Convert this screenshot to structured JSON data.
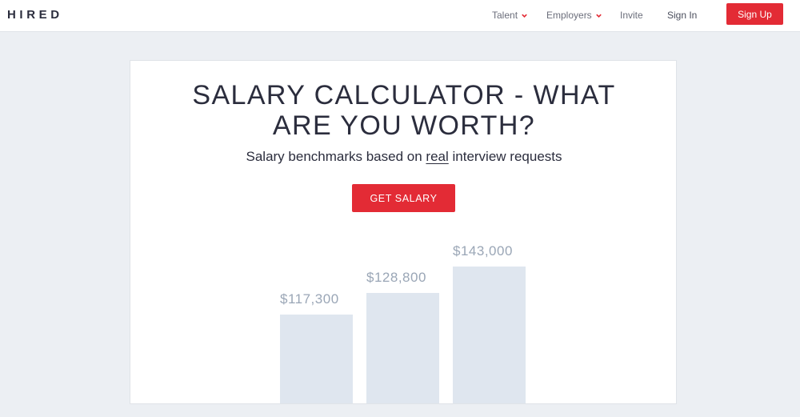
{
  "header": {
    "logo": "HIRED",
    "nav": [
      {
        "label": "Talent",
        "has_dropdown": true
      },
      {
        "label": "Employers",
        "has_dropdown": true
      },
      {
        "label": "Invite",
        "has_dropdown": false
      },
      {
        "label": "Sign In",
        "has_dropdown": false
      }
    ],
    "signup_label": "Sign Up"
  },
  "hero": {
    "title_line1": "SALARY CALCULATOR - WHAT",
    "title_line2": "ARE YOU WORTH?",
    "subtitle_before": "Salary benchmarks based on ",
    "subtitle_underlined": "real",
    "subtitle_after": " interview requests",
    "cta_label": "GET SALARY"
  },
  "colors": {
    "accent": "#e32b35",
    "bar": "#dfe6ef",
    "bar_label": "#9aa6b6",
    "page_bg": "#eceff3"
  },
  "chart_data": {
    "type": "bar",
    "categories": [
      "",
      "",
      ""
    ],
    "values": [
      117300,
      128800,
      143000
    ],
    "data_labels": [
      "$117,300",
      "$128,800",
      "$143,000"
    ]
  }
}
